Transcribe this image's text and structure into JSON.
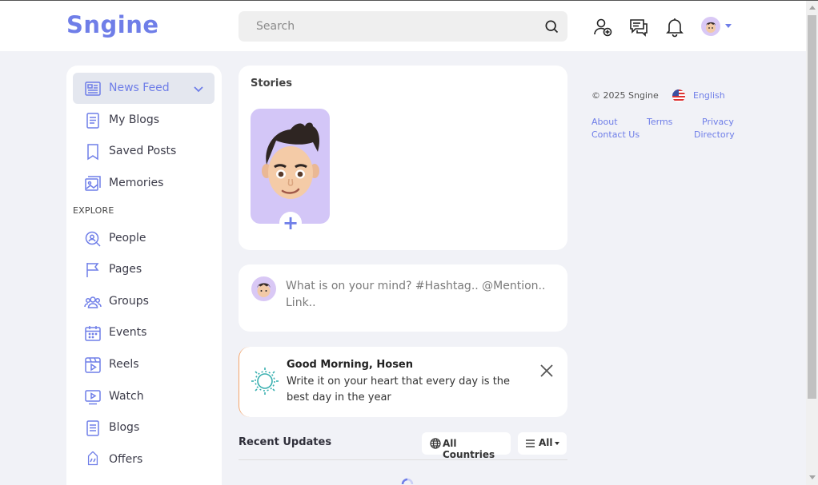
{
  "header": {
    "logo": "Sngine",
    "search_placeholder": "Search"
  },
  "sidebar": {
    "items": [
      {
        "label": "News Feed",
        "icon": "newspaper-icon"
      },
      {
        "label": "My Blogs",
        "icon": "document-icon"
      },
      {
        "label": "Saved Posts",
        "icon": "bookmark-icon"
      },
      {
        "label": "Memories",
        "icon": "photo-album-icon"
      }
    ],
    "section_label": "EXPLORE",
    "explore": [
      {
        "label": "People",
        "icon": "people-search-icon"
      },
      {
        "label": "Pages",
        "icon": "flag-icon"
      },
      {
        "label": "Groups",
        "icon": "groups-icon"
      },
      {
        "label": "Events",
        "icon": "calendar-icon"
      },
      {
        "label": "Reels",
        "icon": "reels-icon"
      },
      {
        "label": "Watch",
        "icon": "watch-video-icon"
      },
      {
        "label": "Blogs",
        "icon": "blog-icon"
      },
      {
        "label": "Offers",
        "icon": "offer-tag-icon"
      }
    ]
  },
  "stories": {
    "title": "Stories",
    "add_symbol": "+"
  },
  "composer": {
    "prompt": "What is on your mind? #Hashtag.. @Mention.. Link.."
  },
  "greeting": {
    "title": "Good Morning, Hosen",
    "text": "Write it on your heart that every day is the best day in the year"
  },
  "recent": {
    "title": "Recent Updates",
    "countries_label": "All Countries",
    "filter_label": "All"
  },
  "footer": {
    "copyright": "© 2025 Sngine",
    "language": "English",
    "links": {
      "about": "About",
      "terms": "Terms",
      "privacy": "Privacy",
      "contact": "Contact Us",
      "directory": "Directory"
    }
  },
  "colors": {
    "accent": "#6f7ee8",
    "background": "#f1f2f7",
    "story_bg": "#d3c6f7",
    "greeting_border": "#f3a46b",
    "sun": "#3ab0b0"
  }
}
